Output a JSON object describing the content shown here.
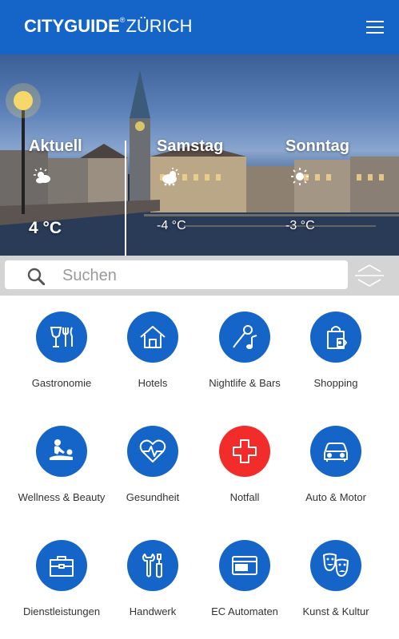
{
  "header": {
    "logo_city": "CITYGUIDE",
    "logo_mark": "®",
    "logo_place": "ZÜRICH",
    "menu_icon": "hamburger-menu-icon"
  },
  "weather": [
    {
      "day": "Aktuell",
      "icon": "partly-cloudy-icon",
      "temp": "4 °C"
    },
    {
      "day": "Samstag",
      "icon": "cloudy-sun-icon",
      "temp": "-4 °C"
    },
    {
      "day": "Sonntag",
      "icon": "sun-icon",
      "temp": "-3 °C"
    }
  ],
  "search": {
    "placeholder": "Suchen",
    "icon": "search-icon",
    "sort_icon": "sort-arrows-icon"
  },
  "categories": [
    {
      "label": "Gastronomie",
      "icon": "restaurant-icon",
      "color": "#1565c9"
    },
    {
      "label": "Hotels",
      "icon": "house-icon",
      "color": "#1565c9"
    },
    {
      "label": "Nightlife & Bars",
      "icon": "microphone-music-icon",
      "color": "#1565c9"
    },
    {
      "label": "Shopping",
      "icon": "shopping-bag-icon",
      "color": "#1565c9"
    },
    {
      "label": "Wellness & Beauty",
      "icon": "massage-icon",
      "color": "#1565c9"
    },
    {
      "label": "Gesundheit",
      "icon": "heartbeat-icon",
      "color": "#1565c9"
    },
    {
      "label": "Notfall",
      "icon": "cross-icon",
      "color": "#f22b2b"
    },
    {
      "label": "Auto & Motor",
      "icon": "car-icon",
      "color": "#1565c9"
    },
    {
      "label": "Dienstleistungen",
      "icon": "briefcase-icon",
      "color": "#1565c9"
    },
    {
      "label": "Handwerk",
      "icon": "tools-icon",
      "color": "#1565c9"
    },
    {
      "label": "EC Automaten",
      "icon": "card-icon",
      "color": "#1565c9"
    },
    {
      "label": "Kunst & Kultur",
      "icon": "theater-masks-icon",
      "color": "#1565c9"
    }
  ],
  "colors": {
    "brand_blue": "#1565c9",
    "emergency_red": "#f22b2b",
    "search_bar_bg": "#d4d4d4"
  }
}
